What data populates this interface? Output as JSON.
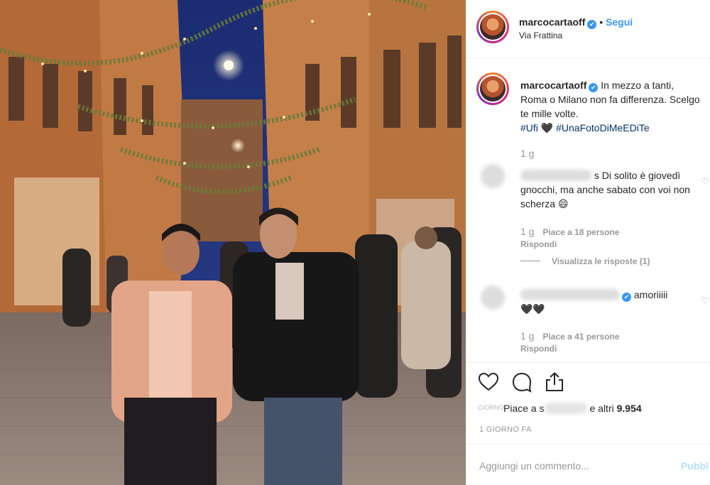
{
  "header": {
    "username": "marcocartaoff",
    "verified_mark": "✔",
    "separator": "•",
    "follow_label": "Segui",
    "location": "Via Frattina"
  },
  "caption": {
    "username": "marcocartaoff",
    "text": "In mezzo a tanti, Roma o Milano non fa differenza. Scelgo te mille volte.",
    "tags": "#Ufi 🖤 #UnaFotoDiMeEDiTe",
    "time": "1 g"
  },
  "comments": [
    {
      "text": "s Di solito è giovedì gnocchi, ma anche sabato con voi non scherza 😄",
      "time": "1 g",
      "likes": "Piace a 18 persone",
      "reply": "Rispondi",
      "view_replies": "Visualizza le risposte (1)"
    },
    {
      "text": "amoriiiii",
      "hearts": "🖤🖤",
      "time": "1 g",
      "likes": "Piace a 41 persone",
      "reply": "Rispondi"
    }
  ],
  "actions": {
    "like_icon": "heart-icon",
    "comment_icon": "comment-bubble-icon",
    "share_icon": "share-icon",
    "under_text": "GIORNO",
    "likes_prefix": "Piace a",
    "likes_blur_gap": "s",
    "likes_suffix": "e altri",
    "likes_count": "9.954",
    "timestamp": "1 GIORNO FA",
    "comment_placeholder": "Aggiungi un commento...",
    "publish_label": "Pubbl"
  },
  "colors": {
    "accent": "#3897f0",
    "hashtag": "#003569",
    "muted": "#999999",
    "publish_disabled": "#b2dffc"
  }
}
